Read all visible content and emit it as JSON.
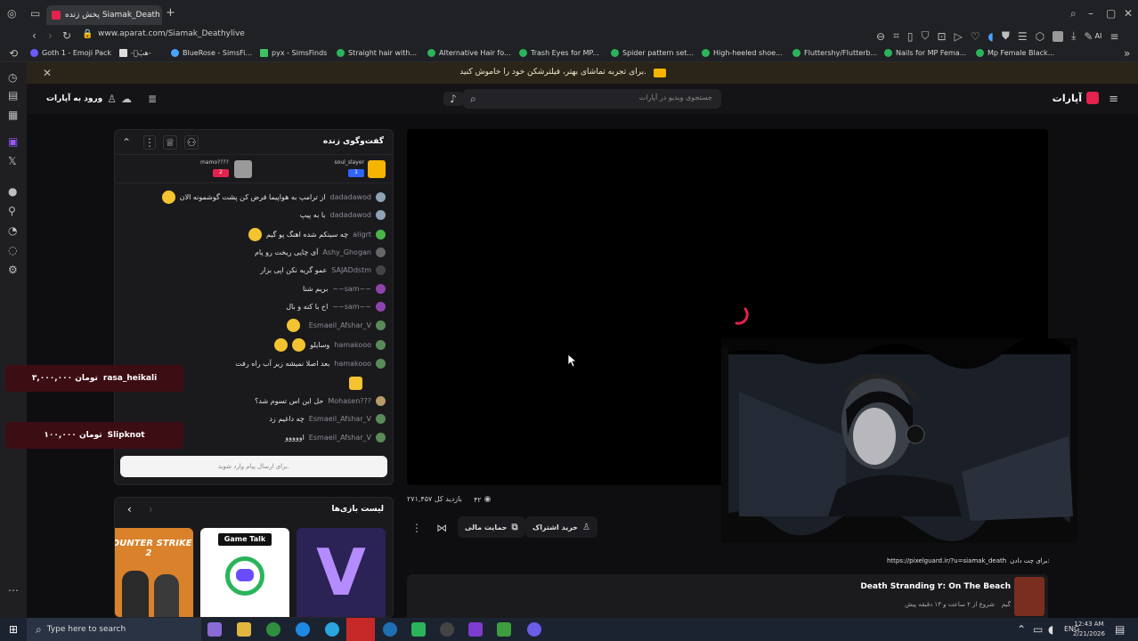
{
  "browser": {
    "tab_title": "پخش زنده Siamak_Death",
    "url": "www.aparat.com/Siamak_Deathylive",
    "ai_label": "AI",
    "bookmarks": [
      "Goth 1 - Emoji Pack",
      "-ه‍ٻٰ۟-",
      "BlueRose - SimsFi...",
      "pyx - SimsFinds",
      "Straight hair with...",
      "Alternative Hair fo...",
      "Trash Eyes for MP...",
      "Spider pattern set...",
      "High-heeled shoe...",
      "Fluttershy/Flutterb...",
      "Nails for MP Fema...",
      "Mp Female Black..."
    ]
  },
  "notice": {
    "text": "برای تجربه تماشای بهتر، فیلترشکن خود را خاموش کنید."
  },
  "header": {
    "logo": "آپارات",
    "search_placeholder": "جستجوی ویدیو در آپارات",
    "login": "ورود به آپارات"
  },
  "chat": {
    "title": "گفت‌وگوی زنده",
    "top_users": [
      {
        "name": "soul_slayer",
        "badge": "1"
      },
      {
        "name": "mamo????",
        "badge": "2"
      }
    ],
    "messages": [
      {
        "user": "dadadawod",
        "text": "از ترامپ به هواپیما فرض کن پشت گوشمونه الان"
      },
      {
        "user": "dadadawod",
        "text": "با به پیپ"
      },
      {
        "user": "aligrt",
        "text": "چه سینکم شده اهنگ پو گیم"
      },
      {
        "user": "Ashy_Ghogan",
        "text": "آی چایی ریخت رو پام"
      },
      {
        "user": "SAJADdstm",
        "text": "عمو گریه نکن اپی بزار"
      },
      {
        "user": "~~sam~~",
        "text": "بریم شنا"
      },
      {
        "user": "~~sam~~",
        "text": "اخ با کنه و بال"
      },
      {
        "user": "Esmaeil_Afshar_V",
        "text": ""
      },
      {
        "user": "hamakooo",
        "text": "وسایلو"
      },
      {
        "user": "hamakooo",
        "text": "بعد اصلا نمیشه زیر آب راه رفت"
      },
      {
        "user": "",
        "text": ""
      },
      {
        "user": "Mohasen???",
        "text": "حل این اس تسوم شد؟"
      },
      {
        "user": "Esmaeil_Afshar_V",
        "text": "چه داغیم زد"
      },
      {
        "user": "Esmaeil_Afshar_V",
        "text": "اووووو"
      }
    ],
    "input_placeholder": "برای ارسال پیام وارد شوید."
  },
  "donations": [
    {
      "user": "rasa_heikali",
      "amount": "۳,۰۰۰,۰۰۰ تومان"
    },
    {
      "user": "Slipknot",
      "amount": "۱۰۰,۰۰۰ تومان"
    }
  ],
  "games": {
    "title": "لیست بازی‌ها",
    "cards": [
      "COUNTER STRIKE 2",
      "Game Talk",
      "V"
    ]
  },
  "stream": {
    "viewers": "۴۲",
    "total_visits": "۲۷۱,۴۵۷ بازدید کل",
    "buy_subscription": "خرید اشتراک",
    "financial_support": "حمایت مالی",
    "chat_link": "https://pixelguard.ir/?u=siamak_death",
    "chat_link_label": "برای چت دادن:"
  },
  "related": {
    "title": "Death Stranding ۲: On The Beach",
    "category": "گیم",
    "meta": "شروع از ۲ ساعت و ۱۳ دقیقه پیش"
  },
  "taskbar": {
    "search": "Type here to search",
    "lang": "ENG",
    "time": "12:43 AM",
    "date": "2/21/2026"
  },
  "colors": {
    "brand": "#e3224d",
    "notice_bg": "#2a2518",
    "donation_bg": "#3d0d14",
    "background": "#0e0e10"
  }
}
